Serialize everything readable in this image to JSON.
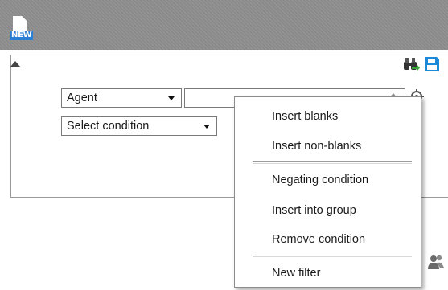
{
  "toolbar": {
    "new_label": "NEW",
    "new_icon": "new-document-icon",
    "accent_color": "#2b7fd4"
  },
  "filter_panel": {
    "collapse_icon": "collapse-up-arrow-icon",
    "search_icon": "binoculars-icon",
    "save_icon": "save-icon",
    "field_select": {
      "selected": "Agent"
    },
    "condition_select": {
      "selected": "Select condition"
    },
    "value_input": {
      "value": ""
    },
    "settings_icon": "gear-icon"
  },
  "lower_area": {
    "user_group_icon": "user-group-icon"
  },
  "context_menu": {
    "items": [
      {
        "label": "Insert blanks"
      },
      {
        "label": "Insert non-blanks"
      },
      {
        "label": "Negating condition"
      },
      {
        "label": "Insert into group"
      },
      {
        "label": "Remove condition"
      },
      {
        "label": "New filter"
      }
    ]
  }
}
